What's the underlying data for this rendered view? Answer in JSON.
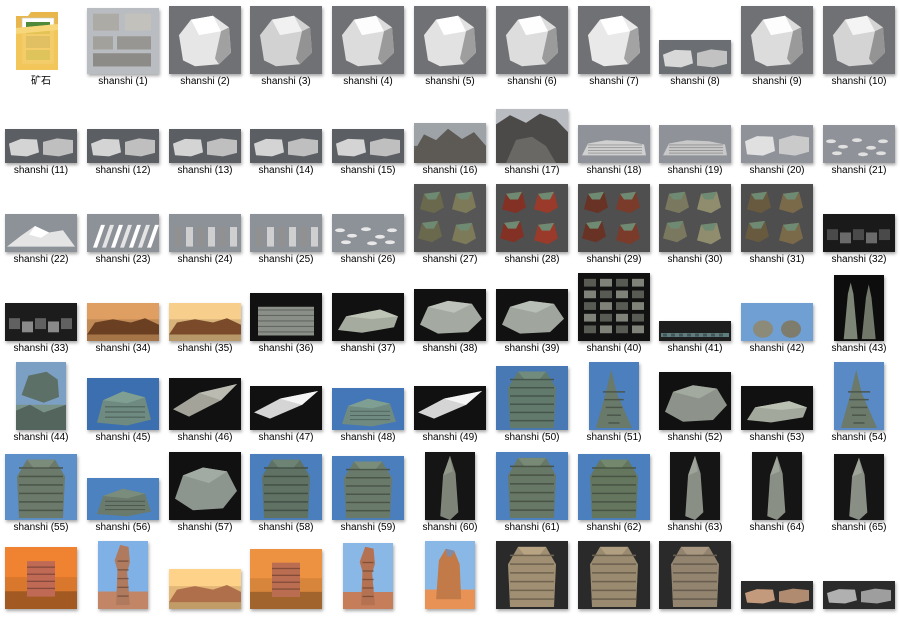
{
  "folder": {
    "label": "矿石",
    "icon": "folder-icon"
  },
  "files": [
    {
      "label": "shanshi (1)",
      "bg": "#b9bcc0",
      "fg": "#d8d6d0",
      "shape": "collage",
      "h": 66
    },
    {
      "label": "shanshi (2)",
      "bg": "#6f7174",
      "fg": "#e6e6e6",
      "shape": "rock",
      "h": 68
    },
    {
      "label": "shanshi (3)",
      "bg": "#6f7174",
      "fg": "#d2d2d2",
      "shape": "rock",
      "h": 68
    },
    {
      "label": "shanshi (4)",
      "bg": "#6f7174",
      "fg": "#dcdcdc",
      "shape": "rock",
      "h": 68
    },
    {
      "label": "shanshi (5)",
      "bg": "#6f7174",
      "fg": "#e2e2e2",
      "shape": "rock",
      "h": 68
    },
    {
      "label": "shanshi (6)",
      "bg": "#6f7174",
      "fg": "#dddddd",
      "shape": "rock",
      "h": 68
    },
    {
      "label": "shanshi (7)",
      "bg": "#6f7174",
      "fg": "#e9e9e9",
      "shape": "rock",
      "h": 68
    },
    {
      "label": "shanshi (8)",
      "bg": "#6b6e72",
      "fg": "#d8d8d8",
      "shape": "pair",
      "h": 34
    },
    {
      "label": "shanshi (9)",
      "bg": "#6f7174",
      "fg": "#dcdcdc",
      "shape": "rock",
      "h": 68
    },
    {
      "label": "shanshi (10)",
      "bg": "#6f7174",
      "fg": "#d4d4d4",
      "shape": "rock",
      "h": 68
    },
    {
      "label": "shanshi (11)",
      "bg": "#5b5e62",
      "fg": "#d4d4d4",
      "shape": "pair",
      "h": 34
    },
    {
      "label": "shanshi (12)",
      "bg": "#5b5e62",
      "fg": "#d4d4d4",
      "shape": "pair",
      "h": 34
    },
    {
      "label": "shanshi (13)",
      "bg": "#5b5e62",
      "fg": "#d4d4d4",
      "shape": "pair",
      "h": 34
    },
    {
      "label": "shanshi (14)",
      "bg": "#5b5e62",
      "fg": "#d4d4d4",
      "shape": "pair",
      "h": 34
    },
    {
      "label": "shanshi (15)",
      "bg": "#5b5e62",
      "fg": "#d4d4d4",
      "shape": "pair",
      "h": 34
    },
    {
      "label": "shanshi (16)",
      "bg": "#9ea3a8",
      "fg": "#5d5a55",
      "shape": "scene",
      "h": 40
    },
    {
      "label": "shanshi (17)",
      "bg": "#b9bdc2",
      "fg": "#4b4a48",
      "shape": "cliff",
      "h": 54
    },
    {
      "label": "shanshi (18)",
      "bg": "#8f9399",
      "fg": "#d0d0d0",
      "shape": "strata",
      "h": 38
    },
    {
      "label": "shanshi (19)",
      "bg": "#8f9399",
      "fg": "#c8c8c8",
      "shape": "strata",
      "h": 38
    },
    {
      "label": "shanshi (20)",
      "bg": "#8f9399",
      "fg": "#e0e0e0",
      "shape": "pair",
      "h": 38
    },
    {
      "label": "shanshi (21)",
      "bg": "#8f9399",
      "fg": "#e0e0e0",
      "shape": "scatter",
      "h": 38
    },
    {
      "label": "shanshi (22)",
      "bg": "#8d9298",
      "fg": "#e4e4e4",
      "shape": "mountain",
      "h": 38
    },
    {
      "label": "shanshi (23)",
      "bg": "#8d9298",
      "fg": "#e4e4e4",
      "shape": "streaks",
      "h": 38
    },
    {
      "label": "shanshi (24)",
      "bg": "#8d9298",
      "fg": "#cfcfcf",
      "shape": "pillars",
      "h": 38
    },
    {
      "label": "shanshi (25)",
      "bg": "#8d9298",
      "fg": "#cfcfcf",
      "shape": "pillars",
      "h": 38
    },
    {
      "label": "shanshi (26)",
      "bg": "#8d9298",
      "fg": "#e8e8e8",
      "shape": "scatter",
      "h": 38
    },
    {
      "label": "shanshi (27)",
      "bg": "#565656",
      "fg": "#7d7a5a",
      "shape": "colorrocks",
      "h": 68
    },
    {
      "label": "shanshi (28)",
      "bg": "#4f4f4f",
      "fg": "#9a3a2a",
      "shape": "colorrocks",
      "h": 68
    },
    {
      "label": "shanshi (29)",
      "bg": "#4f4f4f",
      "fg": "#7a3b2a",
      "shape": "colorrocks",
      "h": 68
    },
    {
      "label": "shanshi (30)",
      "bg": "#515151",
      "fg": "#8f8d6e",
      "shape": "colorrocks",
      "h": 68
    },
    {
      "label": "shanshi (31)",
      "bg": "#4e4e4e",
      "fg": "#7a6a4a",
      "shape": "colorrocks",
      "h": 68
    },
    {
      "label": "shanshi (32)",
      "bg": "#1a1a1a",
      "fg": "#6a6a6a",
      "shape": "darkstrata",
      "h": 38
    },
    {
      "label": "shanshi (33)",
      "bg": "#1c1c1c",
      "fg": "#8a8a8a",
      "shape": "darkstrata",
      "h": 38
    },
    {
      "label": "shanshi (34)",
      "bg": "#c28a55",
      "fg": "#6b3f22",
      "shape": "desert",
      "h": 38
    },
    {
      "label": "shanshi (35)",
      "bg": "#d7b37a",
      "fg": "#7a4a2a",
      "shape": "desert",
      "h": 38
    },
    {
      "label": "shanshi (36)",
      "bg": "#111111",
      "fg": "#8a8f88",
      "shape": "block",
      "h": 48
    },
    {
      "label": "shanshi (37)",
      "bg": "#111111",
      "fg": "#a5ab9e",
      "shape": "slab",
      "h": 48
    },
    {
      "label": "shanshi (38)",
      "bg": "#111111",
      "fg": "#a4aaa2",
      "shape": "flat",
      "h": 52
    },
    {
      "label": "shanshi (39)",
      "bg": "#111111",
      "fg": "#a0a69e",
      "shape": "flat",
      "h": 52
    },
    {
      "label": "shanshi (40)",
      "bg": "#111111",
      "fg": "#7e8278",
      "shape": "gridsheet",
      "h": 68
    },
    {
      "label": "shanshi (41)",
      "bg": "#1e1e1e",
      "fg": "#5f7c7e",
      "shape": "band",
      "h": 20
    },
    {
      "label": "shanshi (42)",
      "bg": "#6f9fd3",
      "fg": "#8c8a78",
      "shape": "twinpillars",
      "h": 38
    },
    {
      "label": "shanshi (43)",
      "bg": "#0d0d0d",
      "fg": "#7d8576",
      "shape": "spires",
      "h": 66
    },
    {
      "label": "shanshi (44)",
      "bg": "#7ca0c4",
      "fg": "#5d7068",
      "shape": "rockscene",
      "h": 68
    },
    {
      "label": "shanshi (45)",
      "bg": "#3b6fb0",
      "fg": "#6f8a80",
      "shape": "boulder",
      "h": 52
    },
    {
      "label": "shanshi (46)",
      "bg": "#111111",
      "fg": "#a3a39a",
      "shape": "shard",
      "h": 52
    },
    {
      "label": "shanshi (47)",
      "bg": "#111111",
      "fg": "#d5d5d5",
      "shape": "shard",
      "h": 44
    },
    {
      "label": "shanshi (48)",
      "bg": "#4477b7",
      "fg": "#6f8a80",
      "shape": "boulder",
      "h": 42
    },
    {
      "label": "shanshi (49)",
      "bg": "#111111",
      "fg": "#d5d5d5",
      "shape": "shard",
      "h": 44
    },
    {
      "label": "shanshi (50)",
      "bg": "#4879b4",
      "fg": "#627a6c",
      "shape": "tower",
      "h": 64
    },
    {
      "label": "shanshi (51)",
      "bg": "#4b7fbe",
      "fg": "#6a7a6a",
      "shape": "cone",
      "h": 68
    },
    {
      "label": "shanshi (52)",
      "bg": "#111111",
      "fg": "#8d938a",
      "shape": "flat",
      "h": 58
    },
    {
      "label": "shanshi (53)",
      "bg": "#111111",
      "fg": "#a2a89c",
      "shape": "slab",
      "h": 44
    },
    {
      "label": "shanshi (54)",
      "bg": "#5a8ac6",
      "fg": "#6b7a6a",
      "shape": "cone",
      "h": 68
    },
    {
      "label": "shanshi (55)",
      "bg": "#5d8fc8",
      "fg": "#6b7a6a",
      "shape": "tower",
      "h": 66
    },
    {
      "label": "shanshi (56)",
      "bg": "#4c82c0",
      "fg": "#6a7a6c",
      "shape": "boulder",
      "h": 42
    },
    {
      "label": "shanshi (57)",
      "bg": "#111111",
      "fg": "#8c958e",
      "shape": "flat",
      "h": 68
    },
    {
      "label": "shanshi (58)",
      "bg": "#4a7ebc",
      "fg": "#5f7264",
      "shape": "tower",
      "h": 66
    },
    {
      "label": "shanshi (59)",
      "bg": "#4a7ebc",
      "fg": "#6a7a6a",
      "shape": "tower",
      "h": 64
    },
    {
      "label": "shanshi (60)",
      "bg": "#151515",
      "fg": "#7e8478",
      "shape": "needle",
      "h": 68
    },
    {
      "label": "shanshi (61)",
      "bg": "#4c80be",
      "fg": "#687866",
      "shape": "tower",
      "h": 68
    },
    {
      "label": "shanshi (62)",
      "bg": "#4b7fbd",
      "fg": "#65765f",
      "shape": "tower",
      "h": 66
    },
    {
      "label": "shanshi (63)",
      "bg": "#151515",
      "fg": "#8a8f86",
      "shape": "needle",
      "h": 68
    },
    {
      "label": "shanshi (64)",
      "bg": "#151515",
      "fg": "#8a8f86",
      "shape": "needle",
      "h": 68
    },
    {
      "label": "shanshi (65)",
      "bg": "#151515",
      "fg": "#8a8f86",
      "shape": "needle",
      "h": 66
    },
    {
      "label": "",
      "bg": "#d9772d",
      "fg": "#c06a56",
      "shape": "desertpillar",
      "h": 62
    },
    {
      "label": "",
      "bg": "#7fb1e6",
      "fg": "#b07a5e",
      "shape": "tallpillar",
      "h": 68
    },
    {
      "label": "",
      "bg": "#e3b778",
      "fg": "#b06f4b",
      "shape": "desert",
      "h": 40
    },
    {
      "label": "",
      "bg": "#d7853a",
      "fg": "#ba6d50",
      "shape": "desertpillar",
      "h": 60
    },
    {
      "label": "",
      "bg": "#8ab8e6",
      "fg": "#b47252",
      "shape": "tallpillar",
      "h": 66
    },
    {
      "label": "",
      "bg": "#8ab8e6",
      "fg": "#c27a48",
      "shape": "hoodoo",
      "h": 68
    },
    {
      "label": "",
      "bg": "#2a2a2a",
      "fg": "#a08f72",
      "shape": "tower",
      "h": 68
    },
    {
      "label": "",
      "bg": "#2a2a2a",
      "fg": "#9a8a70",
      "shape": "tower",
      "h": 68
    },
    {
      "label": "",
      "bg": "#2a2a2a",
      "fg": "#938470",
      "shape": "tower",
      "h": 68
    },
    {
      "label": "",
      "bg": "#2b2b2b",
      "fg": "#c49a7c",
      "shape": "pair",
      "h": 28
    },
    {
      "label": "",
      "bg": "#2b2b2b",
      "fg": "#b0b0b0",
      "shape": "pair",
      "h": 28
    }
  ]
}
